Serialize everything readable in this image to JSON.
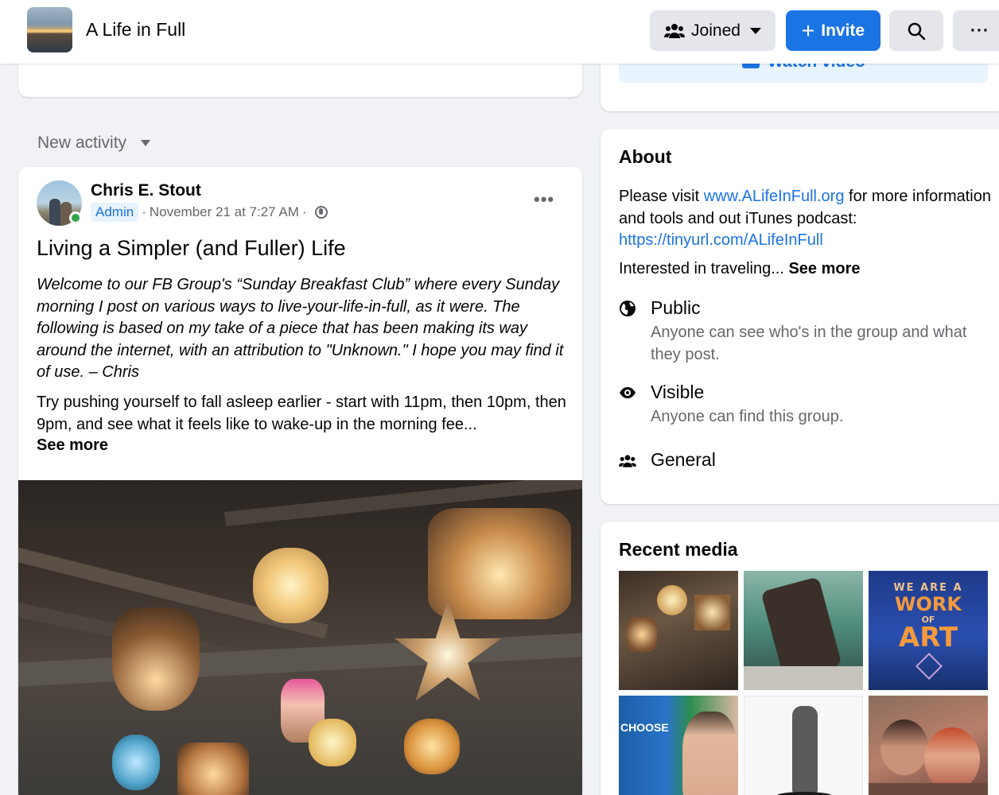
{
  "header": {
    "group_name": "A Life in Full",
    "joined_label": "Joined",
    "invite_label": "Invite",
    "icons": {
      "joined": "people-icon",
      "invite": "plus-icon",
      "search": "search-icon",
      "more": "more-icon"
    }
  },
  "top_right_card": {
    "watch_label": "Watch video"
  },
  "feed": {
    "sort_label": "New activity"
  },
  "post": {
    "author": "Chris E. Stout",
    "role_badge": "Admin",
    "separator": "·",
    "timestamp": "November 21 at 7:27 AM",
    "privacy_icon": "globe-icon",
    "title": "Living a Simpler (and Fuller) Life",
    "intro_italic": "Welcome to our FB Group's “Sunday Breakfast Club” where every Sunday morning I post on various ways to live-your-life-in-full, as it were. The following is based on my take of a piece that has been making its way around the internet, with an attribution to \"Unknown.\" I hope you may find it of use. – Chris",
    "body": "Try pushing yourself to fall asleep earlier - start with 11pm, then 10pm, then 9pm, and see what it feels like to wake-up in the morning fee...",
    "see_more": "See more",
    "more_icon": "more-icon"
  },
  "about": {
    "heading": "About",
    "text_prefix": "Please visit ",
    "website": "www.ALifeInFull.org",
    "text_middle": " for more information and tools and out iTunes podcast: ",
    "podcast_link": "https://tinyurl.com/ALifeInFull",
    "interest_prefix": "Interested in traveling...",
    "see_more": "See more",
    "public_title": "Public",
    "public_desc": "Anyone can see who's in the group and what they post.",
    "visible_title": "Visible",
    "visible_desc": "Anyone can find this group.",
    "general_title": "General"
  },
  "recent_media": {
    "heading": "Recent media",
    "thumb3": {
      "line1": "WE ARE A",
      "line2": "WORK",
      "line3": "OF",
      "line4": "ART"
    },
    "thumb4": {
      "label": "CHOOSE"
    }
  },
  "colors": {
    "accent": "#1b74e4",
    "background": "#f0f2f5",
    "online": "#31a24c"
  }
}
